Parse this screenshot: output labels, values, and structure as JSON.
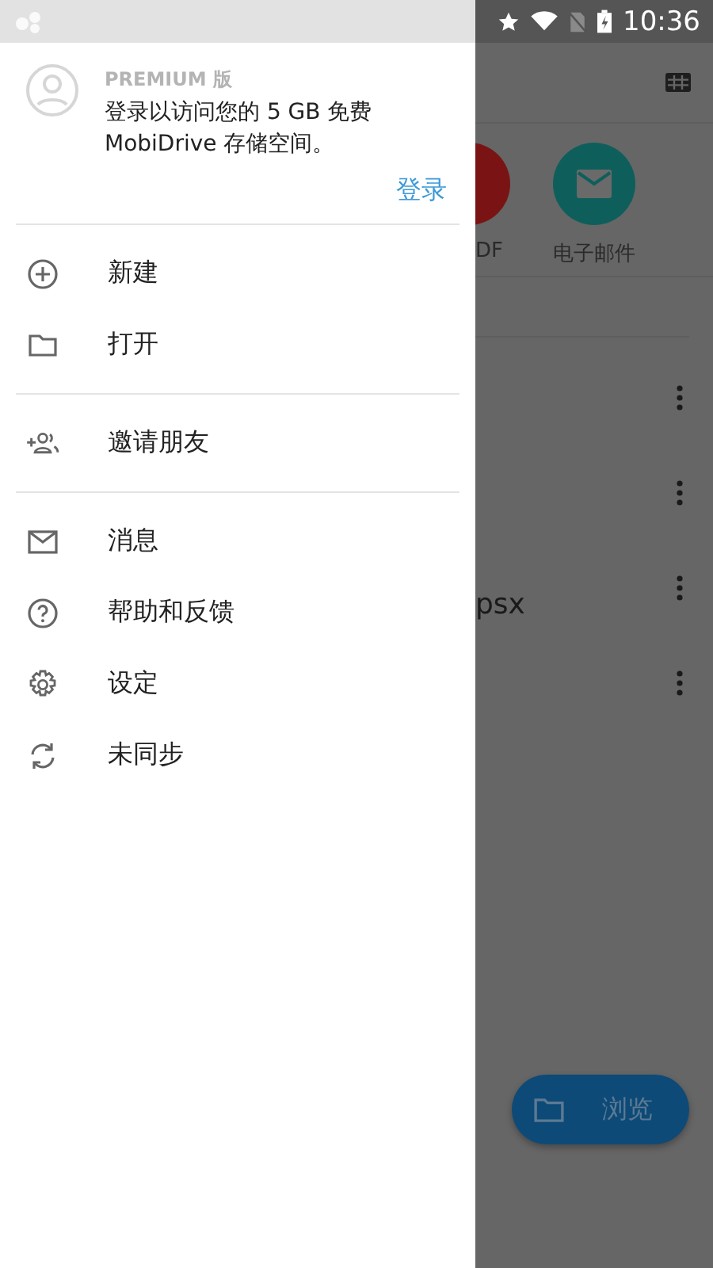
{
  "status_bar": {
    "time": "10:36"
  },
  "drawer": {
    "account": {
      "edition": "PREMIUM 版",
      "message": "登录以访问您的 5 GB 免费 MobiDrive 存储空间。",
      "sign_in": "登录"
    },
    "sections": [
      [
        {
          "kind": "plus",
          "label": "新建"
        },
        {
          "kind": "folder",
          "label": "打开"
        }
      ],
      [
        {
          "kind": "people",
          "label": "邀请朋友"
        }
      ],
      [
        {
          "kind": "mail",
          "label": "消息"
        },
        {
          "kind": "help",
          "label": "帮助和反馈"
        },
        {
          "kind": "gear",
          "label": "设定"
        },
        {
          "kind": "sync",
          "label": "未同步"
        }
      ]
    ]
  },
  "background": {
    "tiles": [
      {
        "kind": "doc",
        "label": "DF",
        "color": "#7a1414"
      },
      {
        "kind": "mail",
        "label": "电子邮件",
        "color": "#0e5f5b"
      }
    ],
    "rows": [
      {
        "kind": "blank"
      },
      {
        "kind": "blank"
      },
      {
        "kind": "named",
        "name": "psx"
      },
      {
        "kind": "blank"
      }
    ],
    "fab": {
      "label": "浏览"
    }
  }
}
